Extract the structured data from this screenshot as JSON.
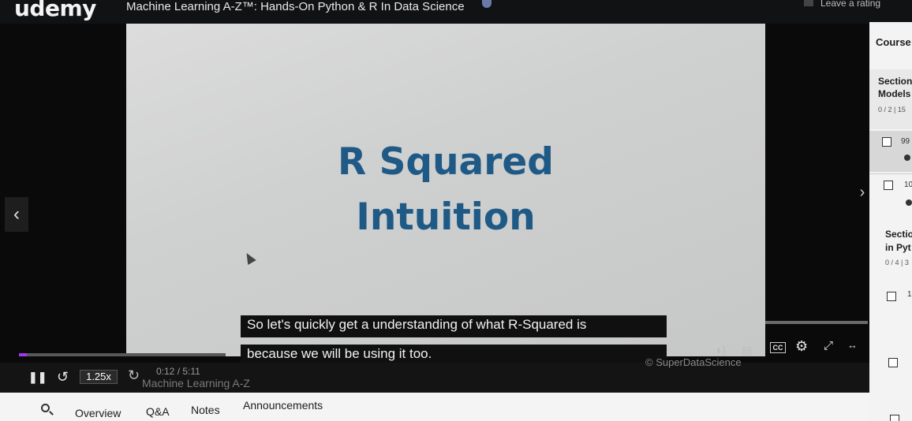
{
  "header": {
    "logo": "udemy",
    "course_title": "Machine Learning A-Z™: Hands-On Python & R In Data Science",
    "rating_label": "Leave a rating"
  },
  "slide": {
    "line1": "R Squared",
    "line2": "Intuition"
  },
  "captions": {
    "line1": "So let's quickly get a understanding of what R-Squared is",
    "line2": "because we will be using it too."
  },
  "player": {
    "speed": "1.25x",
    "time": "0:12 / 5:11",
    "progress": 0.04,
    "watermark": "Machine Learning A-Z",
    "credit": "© SuperDataScience",
    "cc_label": "CC"
  },
  "sidebar": {
    "header": "Course",
    "section1": {
      "title_line1": "Section",
      "title_line2": "Models",
      "progress": "0 / 2 | 15"
    },
    "item1_num": "99",
    "item2_num": "10",
    "section2": {
      "title_line1": "Sectio",
      "title_line2": "in Pyt",
      "progress": "0 / 4 | 3"
    },
    "item3_num": "1"
  },
  "tabs": [
    "Overview",
    "Q&A",
    "Notes",
    "Announcements"
  ],
  "icons": [
    "pause-icon",
    "rewind-icon",
    "forward-icon",
    "volume-icon",
    "notes-icon",
    "cc-icon",
    "gear-icon",
    "expand-icon",
    "fullscreen-icon",
    "search-icon"
  ]
}
